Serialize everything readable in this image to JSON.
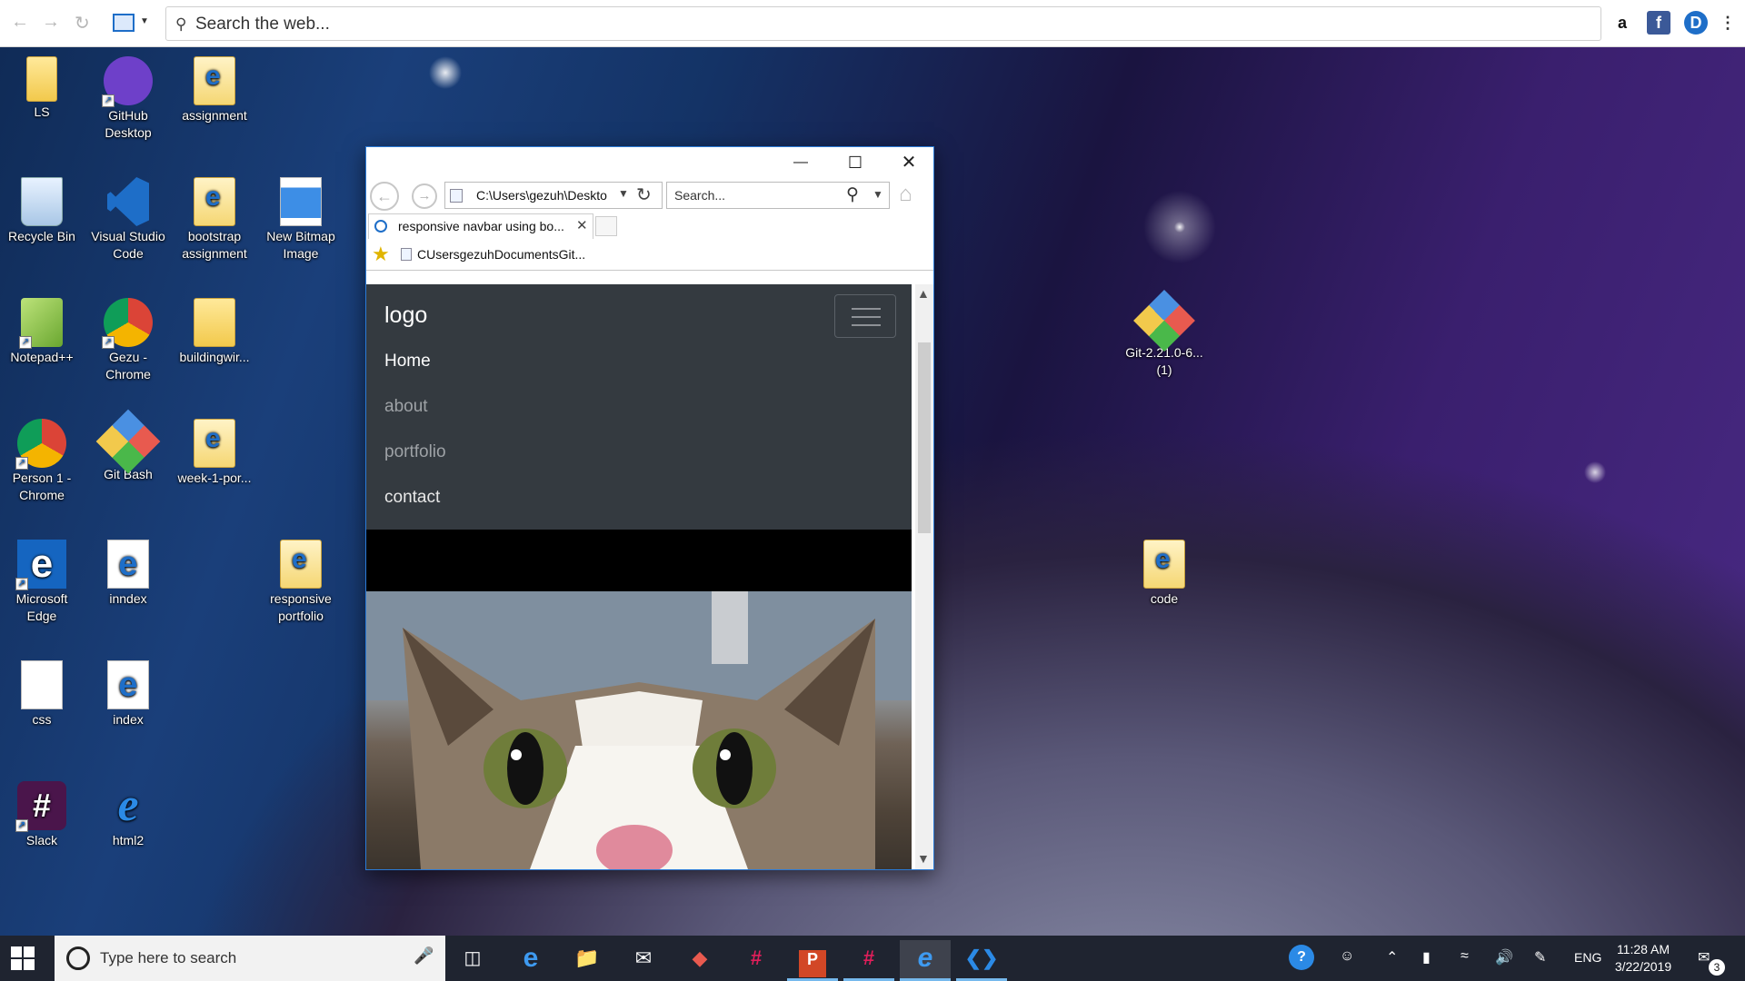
{
  "topbar": {
    "search_placeholder": "Search the web...",
    "ext_amazon": "a",
    "ext_facebook": "f",
    "ext_other": "D"
  },
  "desktop": {
    "icons": [
      {
        "label": "LS"
      },
      {
        "label": "GitHub Desktop"
      },
      {
        "label": "assignment"
      },
      {
        "label": "Recycle Bin"
      },
      {
        "label": "Visual Studio Code"
      },
      {
        "label": "bootstrap assignment"
      },
      {
        "label": "New Bitmap Image"
      },
      {
        "label": "Notepad++"
      },
      {
        "label": "Gezu - Chrome"
      },
      {
        "label": "buildingwir..."
      },
      {
        "label": "Person 1 - Chrome"
      },
      {
        "label": "Git Bash"
      },
      {
        "label": "week-1-por..."
      },
      {
        "label": "Microsoft Edge"
      },
      {
        "label": "inndex"
      },
      {
        "label": "responsive portfolio"
      },
      {
        "label": "css"
      },
      {
        "label": "index"
      },
      {
        "label": "Slack"
      },
      {
        "label": "html2"
      },
      {
        "label": "Git-2.21.0-6... (1)"
      },
      {
        "label": "code"
      }
    ]
  },
  "browser": {
    "address": "C:\\Users\\gezuh\\Deskto",
    "search_placeholder": "Search...",
    "tab_title": "responsive navbar using bo...",
    "favorite_label": "CUsersgezuhDocumentsGit...",
    "page": {
      "brand": "logo",
      "nav": [
        {
          "label": "Home",
          "active": true
        },
        {
          "label": "about",
          "active": false
        },
        {
          "label": "portfolio",
          "active": false
        },
        {
          "label": "contact",
          "active": false
        }
      ]
    }
  },
  "taskbar": {
    "search_placeholder": "Type here to search",
    "language": "ENG",
    "time": "11:28 AM",
    "date": "3/22/2019",
    "notifications_count": "3"
  },
  "colors": {
    "navbar_bg": "#343a40",
    "taskbar_bg": "#1f2430",
    "window_border": "#2b7bd6"
  }
}
